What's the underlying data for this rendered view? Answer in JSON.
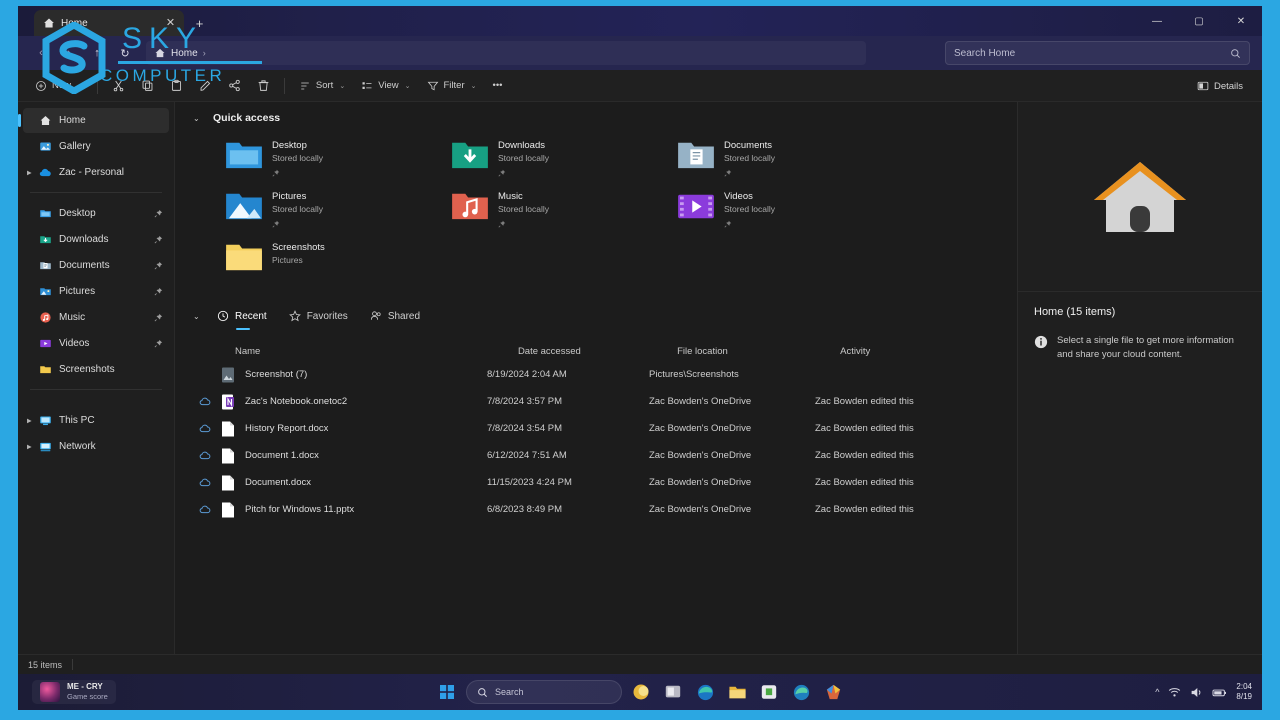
{
  "watermark": {
    "line1": "SKY",
    "line2": "COMPUTER"
  },
  "titlebar": {
    "tab_label": "Home",
    "tab_icon": "home-icon",
    "close_tab": "✕",
    "new_tab": "+",
    "minimize": "—",
    "maximize": "▢",
    "close": "✕"
  },
  "addressbar": {
    "back": "‹",
    "forward": "›",
    "up": "↑",
    "refresh": "↻",
    "breadcrumb": [
      {
        "label": "Home",
        "icon": "home-icon"
      }
    ],
    "breadcrumb_sep": "›",
    "search_placeholder": "Search Home",
    "search_icon": "search-icon"
  },
  "toolbar": {
    "new_label": "New",
    "chevron": "⌄",
    "icons": [
      {
        "name": "cut-icon"
      },
      {
        "name": "copy-icon"
      },
      {
        "name": "paste-icon"
      },
      {
        "name": "rename-icon"
      },
      {
        "name": "share-icon"
      },
      {
        "name": "delete-icon"
      }
    ],
    "sort_label": "Sort",
    "view_label": "View",
    "filter_label": "Filter",
    "overflow_label": "•••",
    "details_label": "Details"
  },
  "sidebar": {
    "top_items": [
      {
        "label": "Home",
        "icon": "home-icon",
        "selected": true,
        "expandable": false,
        "pinned": false
      },
      {
        "label": "Gallery",
        "icon": "gallery-icon",
        "selected": false,
        "expandable": false,
        "pinned": false
      },
      {
        "label": "Zac - Personal",
        "icon": "onedrive-icon",
        "selected": false,
        "expandable": true,
        "pinned": false
      }
    ],
    "pinned_items": [
      {
        "label": "Desktop",
        "icon": "desktop-folder-icon",
        "pinned": true
      },
      {
        "label": "Downloads",
        "icon": "downloads-folder-icon",
        "pinned": true
      },
      {
        "label": "Documents",
        "icon": "documents-folder-icon",
        "pinned": true
      },
      {
        "label": "Pictures",
        "icon": "pictures-folder-icon",
        "pinned": true
      },
      {
        "label": "Music",
        "icon": "music-folder-icon",
        "pinned": true
      },
      {
        "label": "Videos",
        "icon": "videos-folder-icon",
        "pinned": true
      },
      {
        "label": "Screenshots",
        "icon": "yellow-folder-icon",
        "pinned": false
      }
    ],
    "bottom_items": [
      {
        "label": "This PC",
        "icon": "this-pc-icon",
        "expandable": true
      },
      {
        "label": "Network",
        "icon": "network-icon",
        "expandable": true
      }
    ]
  },
  "quick_access": {
    "title": "Quick access",
    "chevron": "⌄",
    "tiles": [
      {
        "name": "Desktop",
        "sub": "Stored locally",
        "icon": "desktop-folder-icon",
        "pinned": true
      },
      {
        "name": "Downloads",
        "sub": "Stored locally",
        "icon": "downloads-folder-icon",
        "pinned": true
      },
      {
        "name": "Documents",
        "sub": "Stored locally",
        "icon": "documents-folder-icon",
        "pinned": true
      },
      {
        "name": "Pictures",
        "sub": "Stored locally",
        "icon": "pictures-folder-icon",
        "pinned": true
      },
      {
        "name": "Music",
        "sub": "Stored locally",
        "icon": "music-folder-icon",
        "pinned": true
      },
      {
        "name": "Videos",
        "sub": "Stored locally",
        "icon": "videos-folder-icon",
        "pinned": true
      },
      {
        "name": "Screenshots",
        "sub": "Pictures",
        "icon": "yellow-folder-icon",
        "pinned": false
      }
    ]
  },
  "recent": {
    "chevron": "⌄",
    "tabs": [
      {
        "label": "Recent",
        "icon": "clock-icon",
        "active": true
      },
      {
        "label": "Favorites",
        "icon": "star-icon",
        "active": false
      },
      {
        "label": "Shared",
        "icon": "shared-icon",
        "active": false
      }
    ],
    "columns": [
      "Name",
      "Date accessed",
      "File location",
      "Activity"
    ],
    "rows": [
      {
        "name": "Screenshot (7)",
        "icon": "image-file-icon",
        "cloud": false,
        "date": "8/19/2024 2:04 AM",
        "location": "Pictures\\Screenshots",
        "activity": ""
      },
      {
        "name": "Zac's Notebook.onetoc2",
        "icon": "onenote-file-icon",
        "cloud": true,
        "date": "7/8/2024 3:57 PM",
        "location": "Zac Bowden's OneDrive",
        "activity": "Zac Bowden edited this"
      },
      {
        "name": "History Report.docx",
        "icon": "doc-file-icon",
        "cloud": true,
        "date": "7/8/2024 3:54 PM",
        "location": "Zac Bowden's OneDrive",
        "activity": "Zac Bowden edited this"
      },
      {
        "name": "Document 1.docx",
        "icon": "doc-file-icon",
        "cloud": true,
        "date": "6/12/2024 7:51 AM",
        "location": "Zac Bowden's OneDrive",
        "activity": "Zac Bowden edited this"
      },
      {
        "name": "Document.docx",
        "icon": "doc-file-icon",
        "cloud": true,
        "date": "11/15/2023 4:24 PM",
        "location": "Zac Bowden's OneDrive",
        "activity": "Zac Bowden edited this"
      },
      {
        "name": "Pitch for Windows 11.pptx",
        "icon": "ppt-file-icon",
        "cloud": true,
        "date": "6/8/2023 8:49 PM",
        "location": "Zac Bowden's OneDrive",
        "activity": "Zac Bowden edited this"
      }
    ]
  },
  "details_pane": {
    "preview_icon": "home-icon-large",
    "title": "Home (15 items)",
    "info_icon": "info-icon",
    "info_text": "Select a single file to get more information and share your cloud content."
  },
  "statusbar": {
    "item_count": "15 items"
  },
  "taskbar": {
    "media_title": "ME - CRY",
    "media_subtitle": "Game score",
    "start_icon": "windows-start-icon",
    "search_placeholder": "Search",
    "search_icon": "search-icon",
    "apps": [
      {
        "name": "copilot-icon"
      },
      {
        "name": "widgets-icon"
      },
      {
        "name": "edge-icon"
      },
      {
        "name": "file-explorer-icon"
      },
      {
        "name": "store-icon"
      },
      {
        "name": "edge-dev-icon"
      },
      {
        "name": "photos-icon"
      }
    ],
    "tray": {
      "overflow": "^",
      "wifi_icon": "wifi-icon",
      "volume_icon": "volume-icon",
      "battery_icon": "battery-icon",
      "time": "2:04",
      "date": "8/19"
    }
  },
  "colors": {
    "accent": "#4cc2ff",
    "watermark": "#2ba7e2",
    "window_bg": "#1c1c1c"
  }
}
